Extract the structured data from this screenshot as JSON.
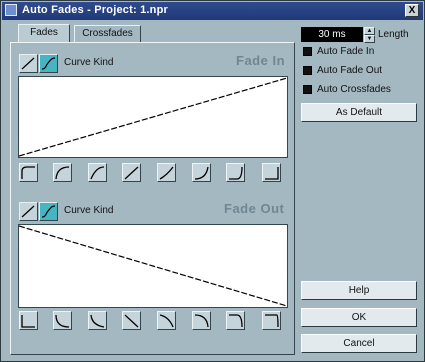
{
  "window": {
    "title": "Auto Fades - Project: 1.npr",
    "close_label": "X"
  },
  "tabs": [
    {
      "label": "Fades",
      "active": true
    },
    {
      "label": "Crossfades",
      "active": false
    }
  ],
  "fade_in": {
    "curve_kind_label": "Curve Kind",
    "title": "Fade In",
    "curve_kind_selected": "spline",
    "presets": [
      "preset-1",
      "preset-2",
      "preset-3",
      "preset-4",
      "preset-5",
      "preset-6",
      "preset-7",
      "preset-8"
    ]
  },
  "fade_out": {
    "curve_kind_label": "Curve Kind",
    "title": "Fade Out",
    "curve_kind_selected": "spline",
    "presets": [
      "preset-1",
      "preset-2",
      "preset-3",
      "preset-4",
      "preset-5",
      "preset-6",
      "preset-7",
      "preset-8"
    ]
  },
  "length": {
    "value": "30 ms",
    "label": "Length"
  },
  "options": [
    {
      "label": "Auto Fade In",
      "checked": false
    },
    {
      "label": "Auto Fade Out",
      "checked": false
    },
    {
      "label": "Auto Crossfades",
      "checked": false
    }
  ],
  "buttons": {
    "as_default": "As Default",
    "help": "Help",
    "ok": "OK",
    "cancel": "Cancel"
  },
  "colors": {
    "titlebar": "#203a78",
    "panel": "#a4b8c2",
    "curve_active": "#47b4c2"
  }
}
